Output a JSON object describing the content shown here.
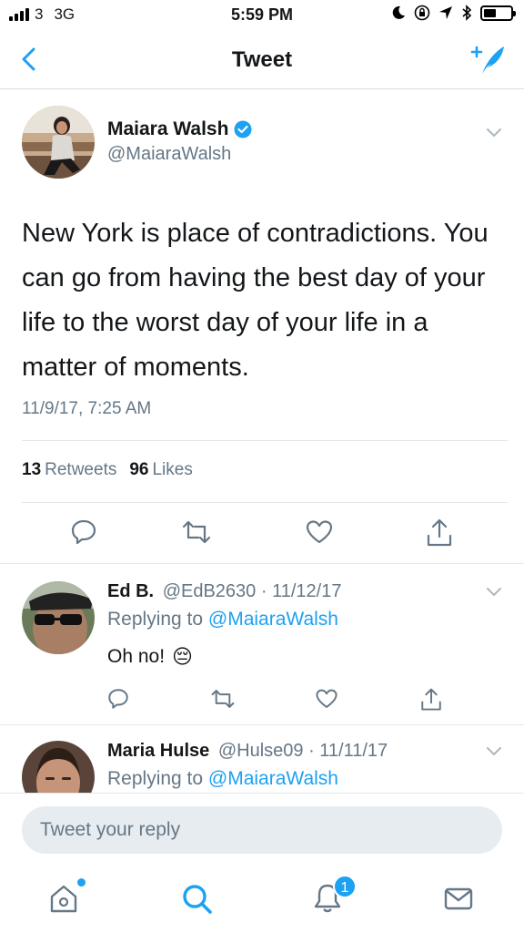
{
  "status_bar": {
    "carrier": "3",
    "network": "3G",
    "time": "5:59 PM",
    "battery_level": 0.45
  },
  "nav": {
    "title": "Tweet",
    "back_icon": "chevron-left-icon",
    "compose_icon": "compose-tweet-icon"
  },
  "tweet": {
    "author_name": "Maiara Walsh",
    "author_handle": "@MaiaraWalsh",
    "verified": true,
    "text": "New York is place of contradictions. You can go from having the best day of your life to the worst day of your life in a matter of moments.",
    "timestamp": "11/9/17, 7:25 AM",
    "retweets_count": "13",
    "retweets_label": "Retweets",
    "likes_count": "96",
    "likes_label": "Likes"
  },
  "replies": [
    {
      "name": "Ed B.",
      "handle": "@EdB2630",
      "date": "11/12/17",
      "replying_prefix": "Replying to",
      "replying_to": "@MaiaraWalsh",
      "text": "Oh no!",
      "emoji": "😔"
    },
    {
      "name": "Maria Hulse",
      "handle": "@Hulse09",
      "date": "11/11/17",
      "replying_prefix": "Replying to",
      "replying_to": "@MaiaraWalsh"
    }
  ],
  "reply_box": {
    "placeholder": "Tweet your reply"
  },
  "tab_bar": {
    "notifications_badge": "1"
  },
  "colors": {
    "accent": "#1da1f2",
    "text_primary": "#14171a",
    "text_secondary": "#657786",
    "divider": "#e1e8ed"
  }
}
